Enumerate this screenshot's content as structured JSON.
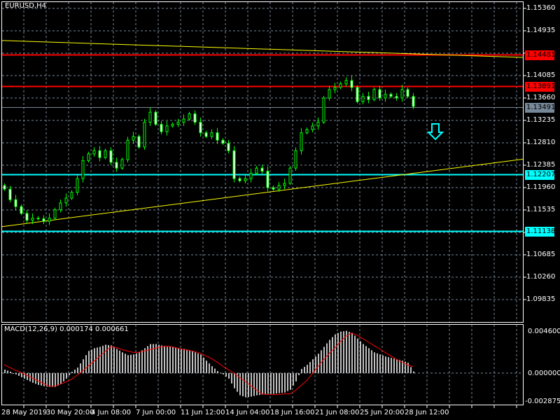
{
  "chart_title": "EURUSD,H4",
  "indicator": {
    "name": "MACD(12,26,9)",
    "main_value": "0.000174",
    "signal_value": "0.000661"
  },
  "colors": {
    "background": "#000000",
    "grid": "#778899",
    "candle": "#00ff00",
    "bull_body": "#000000",
    "bear_body": "#ffffff",
    "resistance": "#ff0000",
    "support": "#00ffff",
    "trendline": "#ffff00",
    "bid": "#778899",
    "histogram": "#c0c0c0",
    "signal": "#ff0000"
  },
  "price_axis": [
    "1.15360",
    "1.14935",
    "1.14085",
    "1.13660",
    "1.13235",
    "1.12810",
    "1.12385",
    "1.11960",
    "1.11535",
    "1.10685",
    "1.10260",
    "1.09835"
  ],
  "macd_axis": [
    "0.004600",
    "0.000000",
    "-0.002875"
  ],
  "time_axis": [
    "28 May 2019",
    "30 May 20:00",
    "4 Jun 08:00",
    "7 Jun 00:00",
    "11 Jun 12:00",
    "14 Jun 04:00",
    "18 Jun 16:00",
    "21 Jun 08:00",
    "25 Jun 20:00",
    "28 Jun 12:00"
  ],
  "levels": [
    {
      "label": "1.14481",
      "price": 1.14481,
      "kind": "resistance"
    },
    {
      "label": "1.13891",
      "price": 1.13891,
      "kind": "resistance"
    },
    {
      "label": "1.13491",
      "price": 1.13491,
      "kind": "bid"
    },
    {
      "label": "1.12207",
      "price": 1.12207,
      "kind": "support"
    },
    {
      "label": "1.11138",
      "price": 1.11138,
      "kind": "support"
    }
  ],
  "chart_data": {
    "type": "candlestick",
    "symbol": "EURUSD",
    "timeframe": "H4",
    "ylim": [
      1.0962,
      1.1545
    ],
    "first_open": 1.12,
    "close": [
      1.1193,
      1.1173,
      1.116,
      1.1147,
      1.1134,
      1.1138,
      1.1137,
      1.1132,
      1.1138,
      1.1154,
      1.1167,
      1.1176,
      1.1187,
      1.1213,
      1.1247,
      1.126,
      1.1266,
      1.1253,
      1.1266,
      1.1244,
      1.1233,
      1.1249,
      1.1286,
      1.1293,
      1.1273,
      1.132,
      1.1339,
      1.1316,
      1.1302,
      1.1313,
      1.1316,
      1.132,
      1.1326,
      1.1336,
      1.132,
      1.13,
      1.1293,
      1.13,
      1.1286,
      1.128,
      1.1266,
      1.1213,
      1.1209,
      1.1213,
      1.1223,
      1.1233,
      1.1227,
      1.1196,
      1.1193,
      1.12,
      1.1204,
      1.1233,
      1.1266,
      1.13,
      1.1306,
      1.1313,
      1.132,
      1.1366,
      1.1382,
      1.1386,
      1.1393,
      1.1399,
      1.1386,
      1.1359,
      1.1369,
      1.1363,
      1.1382,
      1.1366,
      1.1373,
      1.1369,
      1.1366,
      1.1382,
      1.1369,
      1.135
    ],
    "trendlines": [
      {
        "name": "descending",
        "from_price": 1.1475,
        "to_price": 1.1443
      },
      {
        "name": "ascending",
        "from_price": 1.1122,
        "to_price": 1.125
      }
    ],
    "signal_arrow": "down",
    "macd": {
      "ylim": [
        -0.002875,
        0.0046
      ],
      "histogram": [
        0.00035,
        0.00014,
        -0.00014,
        -0.00042,
        -0.0007,
        -0.00098,
        -0.00119,
        -0.00133,
        -0.0014,
        -0.0014,
        -0.00112,
        -0.00056,
        0.00014,
        0.00056,
        0.0014,
        0.00224,
        0.00252,
        0.00266,
        0.00287,
        0.0028,
        0.00245,
        0.0021,
        0.00182,
        0.00189,
        0.0021,
        0.00252,
        0.00294,
        0.00294,
        0.0028,
        0.00266,
        0.00266,
        0.00252,
        0.00245,
        0.00231,
        0.0021,
        0.00189,
        0.00126,
        0.0007,
        0.00021,
        -0.00014,
        -0.00056,
        -0.00154,
        -0.00224,
        -0.00245,
        -0.00238,
        -0.00224,
        -0.00217,
        -0.0021,
        -0.0021,
        -0.00203,
        -0.00196,
        -0.00168,
        -0.00084,
        0.00042,
        0.00084,
        0.0014,
        0.00196,
        0.00266,
        0.00336,
        0.00392,
        0.0042,
        0.00427,
        0.00406,
        0.0035,
        0.00294,
        0.00252,
        0.0021,
        0.00189,
        0.00168,
        0.00154,
        0.0014,
        0.00126,
        0.00105,
        0.000174
      ],
      "signal": [
        0.00084,
        0.00056,
        0.00028,
        7e-05,
        -0.00021,
        -0.00049,
        -0.00077,
        -0.00105,
        -0.00133,
        -0.00133,
        -0.00112,
        -0.00091,
        -0.00063,
        -0.00021,
        0.00021,
        0.0007,
        0.00119,
        0.00168,
        0.00217,
        0.00266,
        0.00259,
        0.00238,
        0.00224,
        0.0021,
        0.0021,
        0.00224,
        0.00238,
        0.00252,
        0.00266,
        0.00273,
        0.00266,
        0.00252,
        0.00238,
        0.00231,
        0.00217,
        0.00203,
        0.00175,
        0.00147,
        0.00112,
        0.0007,
        0.00035,
        0,
        -0.00042,
        -0.00084,
        -0.00126,
        -0.00168,
        -0.0021,
        -0.00217,
        -0.00217,
        -0.00217,
        -0.0021,
        -0.0021,
        -0.00175,
        -0.00126,
        -0.00077,
        -7e-05,
        0.00063,
        0.00133,
        0.00196,
        0.00252,
        0.00315,
        0.00371,
        0.00406,
        0.00385,
        0.0035,
        0.00315,
        0.0028,
        0.00245,
        0.0021,
        0.00175,
        0.0014,
        0.00112,
        0.00084,
        0.000661
      ]
    }
  }
}
